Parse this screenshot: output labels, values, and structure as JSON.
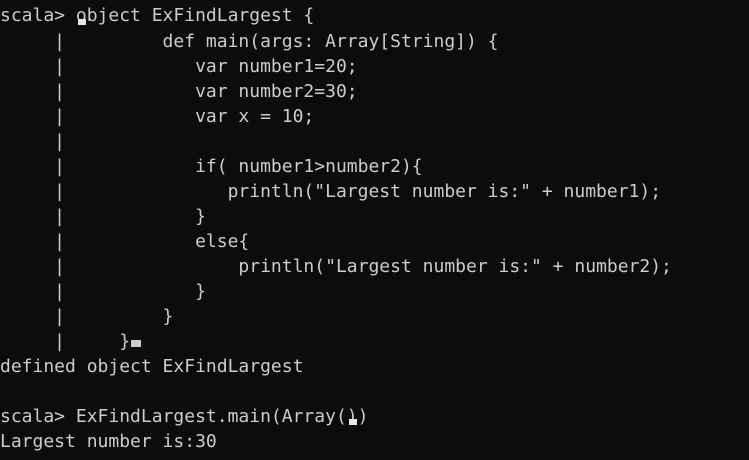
{
  "terminal": {
    "lines": [
      {
        "text": "scala> object ExFindLargest {"
      },
      {
        "text": "     |         def main(args: Array[String]) {"
      },
      {
        "text": "     |            var number1=20;"
      },
      {
        "text": "     |            var number2=30;"
      },
      {
        "text": "     |            var x = 10;"
      },
      {
        "text": "     |"
      },
      {
        "text": "     |            if( number1>number2){"
      },
      {
        "text": "     |               println(\"Largest number is:\" + number1);"
      },
      {
        "text": "     |            }"
      },
      {
        "text": "     |            else{"
      },
      {
        "text": "     |                println(\"Largest number is:\" + number2);"
      },
      {
        "text": "     |            }"
      },
      {
        "text": "     |         }"
      },
      {
        "text": "     |     }"
      },
      {
        "text": "defined object ExFindLargest"
      },
      {
        "text": ""
      },
      {
        "text": "scala> ExFindLargest.main(Array())"
      },
      {
        "text": "Largest number is:30"
      }
    ]
  }
}
